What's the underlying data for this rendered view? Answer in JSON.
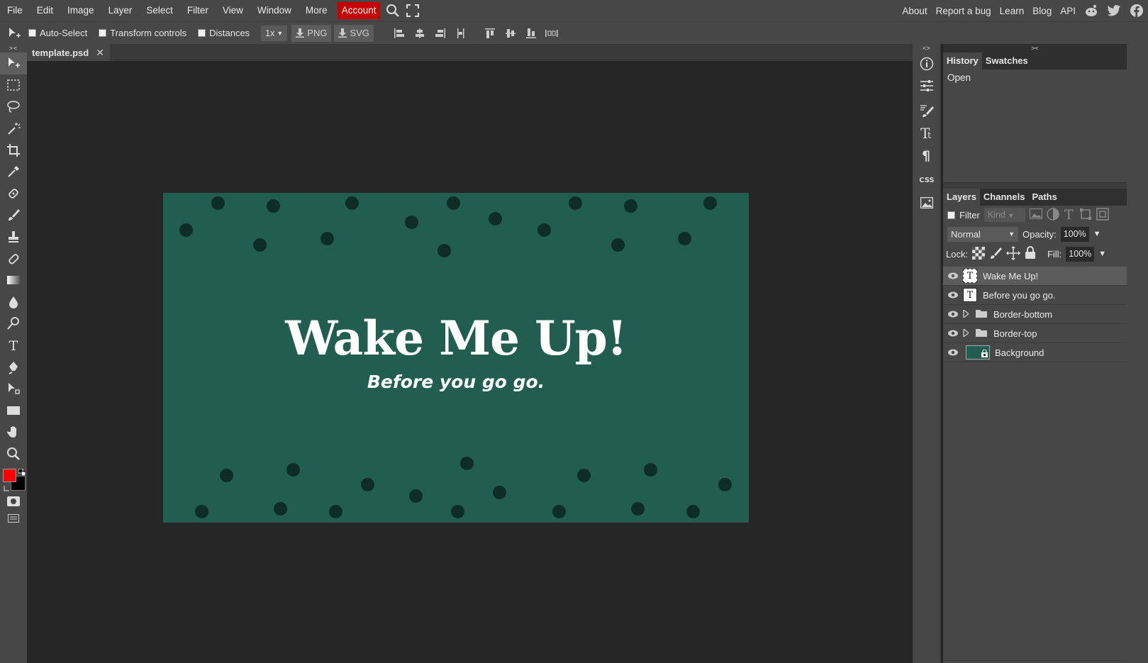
{
  "menu": {
    "items": [
      "File",
      "Edit",
      "Image",
      "Layer",
      "Select",
      "Filter",
      "View",
      "Window",
      "More"
    ],
    "account": "Account",
    "right_links": [
      "About",
      "Report a bug",
      "Learn",
      "Blog",
      "API"
    ],
    "social_icons": [
      "reddit-icon",
      "twitter-icon",
      "facebook-icon"
    ]
  },
  "options": {
    "auto_select": "Auto-Select",
    "transform_controls": "Transform controls",
    "distances": "Distances",
    "scale": "1x",
    "png": "PNG",
    "svg": "SVG"
  },
  "document": {
    "tab_name": "template.psd",
    "canvas_color": "#215e4f",
    "title": "Wake Me Up!",
    "subtitle": "Before you go go."
  },
  "colors": {
    "foreground": "#ff0000",
    "background": "#000000"
  },
  "side_icons": {
    "css": "CSS"
  },
  "panels": {
    "top_tabs": [
      "History",
      "Swatches"
    ],
    "history": [
      "Open"
    ],
    "layer_tabs": [
      "Layers",
      "Channels",
      "Paths"
    ],
    "filter": "Filter",
    "kind": "Kind",
    "blend_mode": "Normal",
    "opacity_label": "Opacity:",
    "opacity": "100%",
    "lock_label": "Lock:",
    "fill_label": "Fill:",
    "fill": "100%",
    "layers": [
      {
        "name": "Wake Me Up!",
        "type": "text",
        "selected": true
      },
      {
        "name": "Before you go go.",
        "type": "text",
        "selected": false
      },
      {
        "name": "Border-bottom",
        "type": "folder",
        "selected": false
      },
      {
        "name": "Border-top",
        "type": "folder",
        "selected": false
      },
      {
        "name": "Background",
        "type": "image",
        "selected": false
      }
    ],
    "footer_eff": "eff"
  }
}
